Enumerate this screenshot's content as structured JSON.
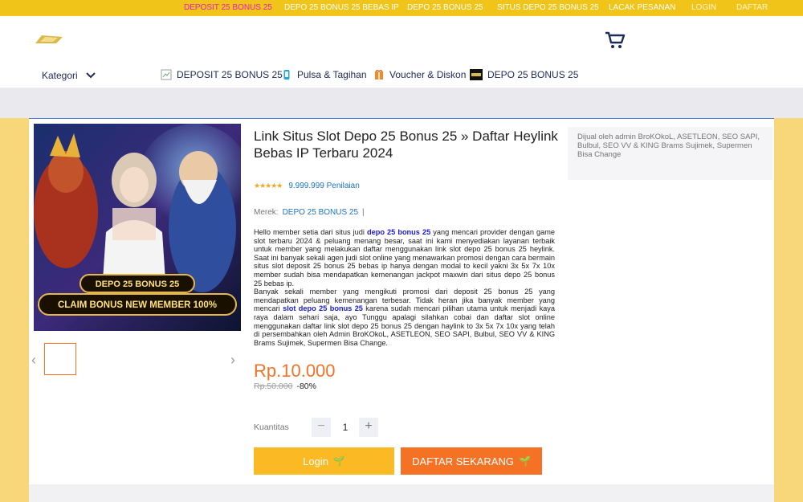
{
  "topbar": {
    "links": [
      {
        "label": "DEPOSIT 25 BONUS 25"
      },
      {
        "label": "DEPO 25 BONUS 25 BEBAS IP"
      },
      {
        "label": "DEPO 25 BONUS 25"
      },
      {
        "label": "SITUS DEPO 25 BONUS 25"
      },
      {
        "label": "LACAK PESANAN"
      },
      {
        "label": "LOGIN"
      },
      {
        "label": "DAFTAR"
      }
    ]
  },
  "header": {
    "kategori_label": "Kategori",
    "nav": [
      {
        "label": "DEPOSIT 25 BONUS 25",
        "icon": "broken-image-icon"
      },
      {
        "label": "Pulsa & Tagihan",
        "icon": "phone-icon"
      },
      {
        "label": "Voucher & Diskon",
        "icon": "voucher-icon"
      },
      {
        "label": "DEPO 25 BONUS 25",
        "icon": "brand-thumb-icon"
      }
    ]
  },
  "product": {
    "banner_line1": "DEPO 25 BONUS 25",
    "banner_line2": "CLAIM BONUS NEW MEMBER 100%",
    "title": "Link Situs Slot Depo 25 Bonus 25 » Daftar Heylink Bebas IP Terbaru 2024",
    "stars": "★★★★★",
    "rating_text": "9.999.999 Penilaian",
    "brand_label": "Merek:",
    "brand_value": "DEPO 25 BONUS 25",
    "brand_sep": "|",
    "desc": {
      "p1_before": "Hello member setia dari situs judi ",
      "p1_link": "depo 25 bonus 25",
      "p1_after": " yang mencari provider dengan game slot terbaru 2024 & peluang menang besar, saat ini kami menyediakan layanan terbaik untuk member yang melakukan daftar menggunakan link slot depo 25 bonus 25 heylink. Saat ini banyak sekali agen judi slot online yang menawarkan promosi dengan cara bermain situs slot deposit 25 bonus 25 bebas ip hanya dengan modal to kecil yakni 3x 5x 7x 10x member sudah bisa mendapatkan kemenangan jackpot maxwin dari situs depo 25 bonus 25 bebas ip.",
      "p2_before": "Banyak sekali member yang mengikuti promosi dari deposit 25 bonus 25 yang mendapatkan peluang kemenangan terbesar. Tidak heran jika banyak member yang mencari ",
      "p2_link": "slot depo 25 bonus 25",
      "p2_after": " karena sudah mencari pilihan utama untuk menjadi kaya raya dalam sehari saja, ayo Tunggu apalagi silahkan cobai dan daftar slot online menggunakan daftar link slot depo 25 bonus 25 dengan haylink to 3x 5x 7x 10x yang telah di persembahkan oleh Admin BroKOkoL, ASETLEON, SEO SAPI, Bulbul, SEO VV & KING Brams Sujimek, Supermen Bisa Change."
    },
    "price": "Rp.10.000",
    "old_price": "Rp.50.000",
    "discount": "-80%",
    "qty_label": "Kuantitas",
    "qty_minus": "−",
    "qty_value": "1",
    "qty_plus": "+",
    "login_label": "Login",
    "daftar_label": "DAFTAR SEKARANG",
    "btn_icon": "sprout-icon"
  },
  "seller": {
    "text": "Dijual oleh admin BroKOkoL, ASETLEON, SEO SAPI, Bulbul, SEO VV & KING Brams Sujimek, Supermen Bisa Change"
  },
  "colors": {
    "accent_orange": "#f57224",
    "accent_yellow": "#fbb923",
    "topbar": "#f0c419",
    "page_bg": "#f7d77a",
    "link_blue": "#1a73c8"
  }
}
